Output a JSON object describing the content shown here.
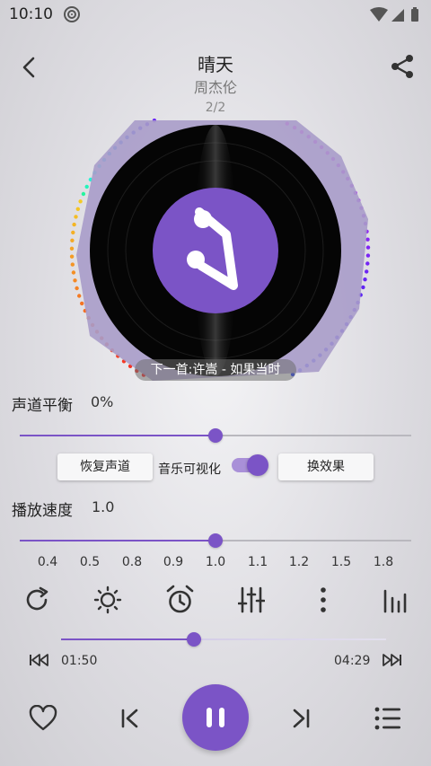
{
  "status": {
    "time": "10:10"
  },
  "song": {
    "title": "晴天",
    "artist": "周杰伦",
    "counter": "2/2",
    "next_hint": "下一首:许嵩 - 如果当时"
  },
  "balance": {
    "label": "声道平衡",
    "value": "0%",
    "level": 0.5
  },
  "buttons": {
    "restore": "恢复声道",
    "visualize_label": "音乐可视化",
    "switch_effect": "换效果"
  },
  "visualize_on": true,
  "speed": {
    "label": "播放速度",
    "value": "1.0",
    "ticks": [
      "0.4",
      "0.5",
      "0.8",
      "0.9",
      "1.0",
      "1.1",
      "1.2",
      "1.5",
      "1.8"
    ]
  },
  "progress": {
    "current": "01:50",
    "total": "04:29",
    "fraction": 0.41
  },
  "colors": {
    "accent": "#7b54c6"
  },
  "icons": {
    "controls": [
      "repeat-icon",
      "brightness-icon",
      "alarm-icon",
      "equalizer-icon",
      "more-vert-icon",
      "spectrum-icon"
    ],
    "player": [
      "heart-icon",
      "previous-icon",
      "pause-icon",
      "next-icon",
      "playlist-icon"
    ]
  }
}
